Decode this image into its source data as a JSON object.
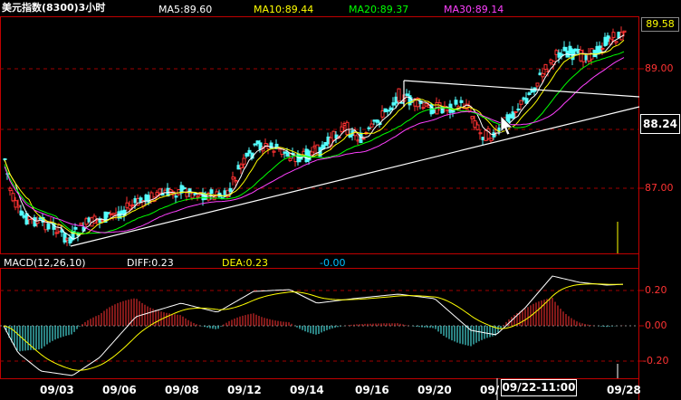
{
  "header": {
    "title": "美元指数(8300)3小时",
    "ma5": "MA5:89.60",
    "ma10": "MA10:89.44",
    "ma20": "MA20:89.37",
    "ma30": "MA30:89.14"
  },
  "macd_header": {
    "name": "MACD(12,26,10)",
    "diff": "DIFF:0.23",
    "dea": "DEA:0.23",
    "macd": "-0.00"
  },
  "price_axis": [
    "89.58",
    "89.00",
    "88.24",
    "87.00"
  ],
  "macd_axis": [
    "0.20",
    "0.00",
    "-0.20"
  ],
  "date_axis": [
    "09/03",
    "09/06",
    "09/08",
    "09/12",
    "09/14",
    "09/16",
    "09/20",
    "09/",
    "09/28"
  ],
  "crosshair_date": "09/22-11:00",
  "current_price": "88.24",
  "last_price": "89.58",
  "colors": {
    "up": "#ff3232",
    "down": "#54ffff",
    "ma5": "#ffffff",
    "ma10": "#ffff00",
    "ma20": "#00ff00",
    "ma30": "#ff40ff",
    "grid": "#a00000"
  }
}
